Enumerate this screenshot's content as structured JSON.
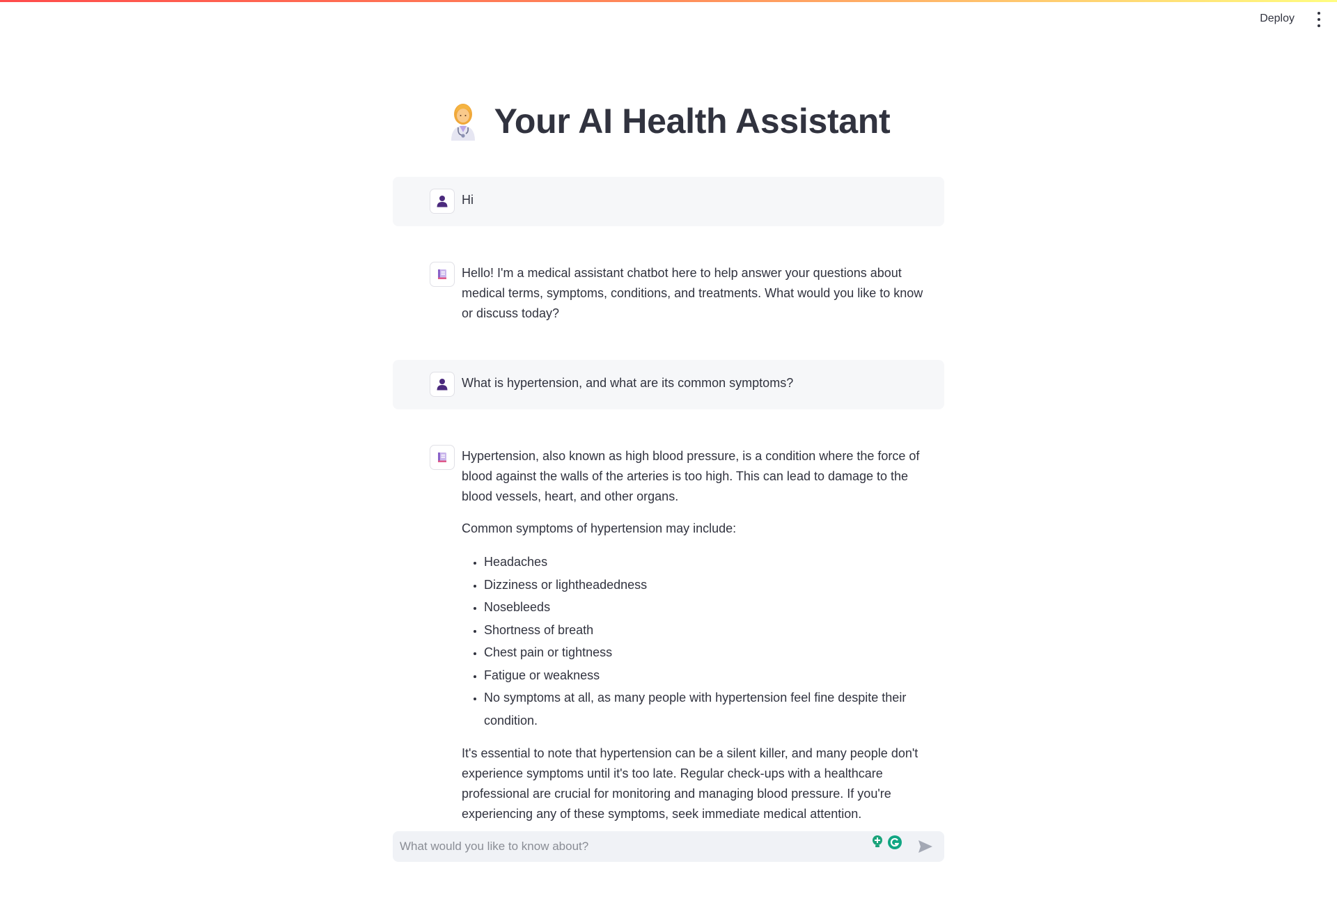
{
  "header": {
    "deploy_label": "Deploy",
    "menu_icon": "more-vertical-icon"
  },
  "page": {
    "title": "Your AI Health Assistant",
    "title_icon": "woman-health-worker-icon"
  },
  "messages": [
    {
      "role": "user",
      "avatar_icon": "user-icon",
      "text": "Hi"
    },
    {
      "role": "assistant",
      "avatar_icon": "assistant-icon",
      "paragraphs": [
        "Hello! I'm a medical assistant chatbot here to help answer your questions about medical terms, symptoms, conditions, and treatments. What would you like to know or discuss today?"
      ]
    },
    {
      "role": "user",
      "avatar_icon": "user-icon",
      "text": "What is hypertension, and what are its common symptoms?"
    },
    {
      "role": "assistant",
      "avatar_icon": "assistant-icon",
      "intro": "Hypertension, also known as high blood pressure, is a condition where the force of blood against the walls of the arteries is too high. This can lead to damage to the blood vessels, heart, and other organs.",
      "lead": "Common symptoms of hypertension may include:",
      "bullets": [
        "Headaches",
        "Dizziness or lightheadedness",
        "Nosebleeds",
        "Shortness of breath",
        "Chest pain or tightness",
        "Fatigue or weakness",
        "No symptoms at all, as many people with hypertension feel fine despite their condition."
      ],
      "outro": "It's essential to note that hypertension can be a silent killer, and many people don't experience symptoms until it's too late. Regular check-ups with a healthcare professional are crucial for monitoring and managing blood pressure. If you're experiencing any of these symptoms, seek immediate medical attention."
    }
  ],
  "chat_input": {
    "placeholder": "What would you like to know about?",
    "value": "",
    "send_icon": "send-icon"
  },
  "colors": {
    "accent_gradient_start": "#ff4b4b",
    "accent_gradient_end": "#fffd80",
    "user_bubble": "#f6f7f9",
    "input_bg": "#f0f2f6",
    "user_avatar": "#4b2a7d",
    "text": "#31333f"
  }
}
